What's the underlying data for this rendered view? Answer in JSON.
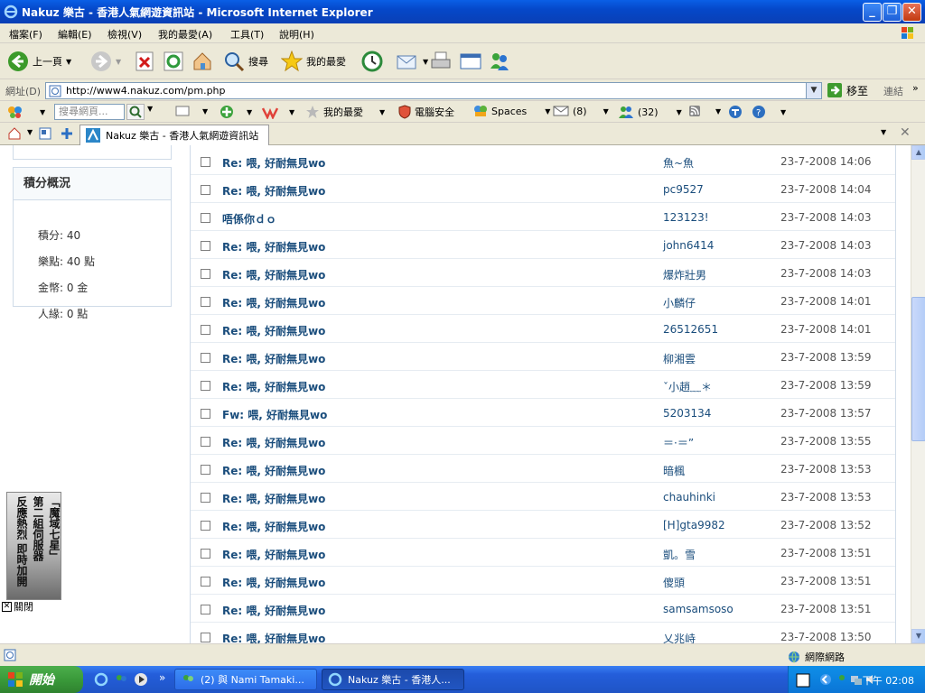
{
  "window": {
    "title": "Nakuz 樂古 - 香港人氣網遊資訊站 - Microsoft Internet Explorer"
  },
  "menu": {
    "items": [
      "檔案(F)",
      "編輯(E)",
      "檢視(V)",
      "我的最愛(A)",
      "工具(T)",
      "說明(H)"
    ]
  },
  "toolbar": {
    "back_label": "上一頁",
    "search_label": "搜尋",
    "favorites_label": "我的最愛"
  },
  "address": {
    "label": "網址(D)",
    "url": "http://www4.nakuz.com/pm.php",
    "go_label": "移至",
    "links_label": "連結"
  },
  "linksbar": {
    "search_placeholder": "搜尋網頁...",
    "favorites_label": "我的最愛",
    "security_label": "電腦安全",
    "spaces_label": "Spaces",
    "mail_count": "(8)",
    "contacts_count": "(32)"
  },
  "tab": {
    "title": "Nakuz 樂古 - 香港人氣網遊資訊站"
  },
  "sidebar": {
    "score_header": "積分概況",
    "rows": [
      "積分: 40",
      "樂點: 40 點",
      "金幣: 0 金",
      "人緣: 0 點"
    ]
  },
  "pm_list": [
    {
      "subject": "Re: 喂, 好耐無見wo",
      "sender": "魚~魚",
      "time": "23-7-2008 14:06"
    },
    {
      "subject": "Re: 喂, 好耐無見wo",
      "sender": "pc9527",
      "time": "23-7-2008 14:04"
    },
    {
      "subject": "唔係你ｄｏ",
      "sender": "123123!",
      "time": "23-7-2008 14:03"
    },
    {
      "subject": "Re: 喂, 好耐無見wo",
      "sender": "john6414",
      "time": "23-7-2008 14:03"
    },
    {
      "subject": "Re: 喂, 好耐無見wo",
      "sender": "爆炸壯男",
      "time": "23-7-2008 14:03"
    },
    {
      "subject": "Re: 喂, 好耐無見wo",
      "sender": "小麟仔",
      "time": "23-7-2008 14:01"
    },
    {
      "subject": "Re: 喂, 好耐無見wo",
      "sender": "26512651",
      "time": "23-7-2008 14:01"
    },
    {
      "subject": "Re: 喂, 好耐無見wo",
      "sender": "柳湘雲",
      "time": "23-7-2008 13:59"
    },
    {
      "subject": "Re: 喂, 好耐無見wo",
      "sender": "ˇ小趙﹏＊",
      "time": "23-7-2008 13:59"
    },
    {
      "subject": "Fw: 喂, 好耐無見wo",
      "sender": "5203134",
      "time": "23-7-2008 13:57"
    },
    {
      "subject": "Re: 喂, 好耐無見wo",
      "sender": "＝·＝”",
      "time": "23-7-2008 13:55"
    },
    {
      "subject": "Re: 喂, 好耐無見wo",
      "sender": "暗楓",
      "time": "23-7-2008 13:53"
    },
    {
      "subject": "Re: 喂, 好耐無見wo",
      "sender": "chauhinki",
      "time": "23-7-2008 13:53"
    },
    {
      "subject": "Re: 喂, 好耐無見wo",
      "sender": "[H]gta9982",
      "time": "23-7-2008 13:52"
    },
    {
      "subject": "Re: 喂, 好耐無見wo",
      "sender": "凱。雪",
      "time": "23-7-2008 13:51"
    },
    {
      "subject": "Re: 喂, 好耐無見wo",
      "sender": "傻頭",
      "time": "23-7-2008 13:51"
    },
    {
      "subject": "Re: 喂, 好耐無見wo",
      "sender": "samsamsoso",
      "time": "23-7-2008 13:51"
    },
    {
      "subject": "Re: 喂, 好耐無見wo",
      "sender": "乂兆峙",
      "time": "23-7-2008 13:50"
    }
  ],
  "ad": {
    "columns": [
      "「魔域七星」",
      "第二組伺服器",
      "反應熱烈 即時加開"
    ],
    "close_label": "關閉"
  },
  "status": {
    "zone_label": "網際網路"
  },
  "taskbar": {
    "start_label": "開始",
    "tasks": [
      "(2) 與 Nami Tamaki...",
      "Nakuz 樂古 - 香港人..."
    ],
    "clock": "下午 02:08"
  }
}
